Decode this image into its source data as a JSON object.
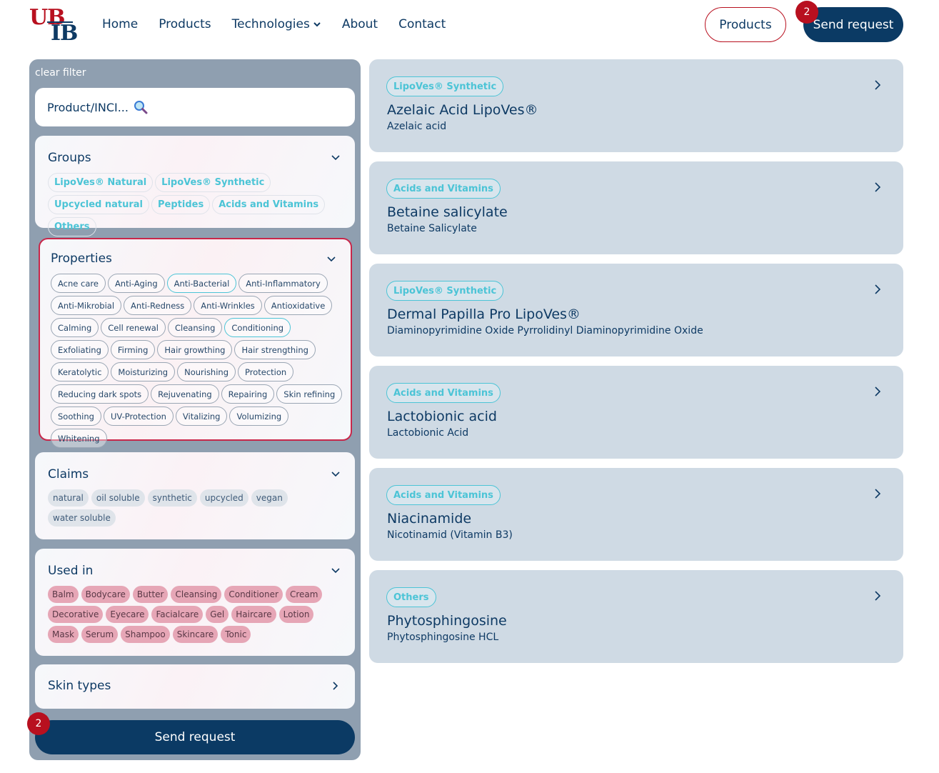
{
  "header": {
    "logo_top": "UB",
    "logo_bottom": "IB",
    "nav": [
      "Home",
      "Products",
      "Technologies",
      "About",
      "Contact"
    ],
    "products_button": "Products",
    "send_request_button": "Send request",
    "request_count": "2"
  },
  "sidebar": {
    "clear_filter": "clear filter",
    "search_placeholder": "Product/INCI...",
    "groups": {
      "title": "Groups",
      "items": [
        "LipoVes® Natural",
        "LipoVes® Synthetic",
        "Upcycled natural",
        "Peptides",
        "Acids and Vitamins",
        "Others"
      ]
    },
    "properties": {
      "title": "Properties",
      "items": [
        "Acne care",
        "Anti-Aging",
        "Anti-Bacterial",
        "Anti-Inflammatory",
        "Anti-Mikrobial",
        "Anti-Redness",
        "Anti-Wrinkles",
        "Antioxidative",
        "Calming",
        "Cell renewal",
        "Cleansing",
        "Conditioning",
        "Exfoliating",
        "Firming",
        "Hair growthing",
        "Hair strengthing",
        "Keratolytic",
        "Moisturizing",
        "Nourishing",
        "Protection",
        "Reducing dark spots",
        "Rejuvenating",
        "Repairing",
        "Skin refining",
        "Soothing",
        "UV-Protection",
        "Vitalizing",
        "Volumizing",
        "Whitening"
      ],
      "selected": [
        "Anti-Bacterial",
        "Conditioning"
      ]
    },
    "claims": {
      "title": "Claims",
      "items": [
        "natural",
        "oil soluble",
        "synthetic",
        "upcycled",
        "vegan",
        "water soluble"
      ]
    },
    "used_in": {
      "title": "Used in",
      "items": [
        "Balm",
        "Bodycare",
        "Butter",
        "Cleansing",
        "Conditioner",
        "Cream",
        "Decorative",
        "Eyecare",
        "Facialcare",
        "Gel",
        "Haircare",
        "Lotion",
        "Mask",
        "Serum",
        "Shampoo",
        "Skincare",
        "Tonic"
      ]
    },
    "skin_types": {
      "title": "Skin types"
    },
    "send_request": "Send request",
    "request_count": "2"
  },
  "products": [
    {
      "tag": "LipoVes® Synthetic",
      "name": "Azelaic Acid LipoVes®",
      "inci": "Azelaic acid"
    },
    {
      "tag": "Acids and Vitamins",
      "name": "Betaine salicylate",
      "inci": "Betaine Salicylate"
    },
    {
      "tag": "LipoVes® Synthetic",
      "name": "Dermal Papilla Pro LipoVes®",
      "inci": "Diaminopyrimidine Oxide Pyrrolidinyl Diaminopyrimidine Oxide"
    },
    {
      "tag": "Acids and Vitamins",
      "name": "Lactobionic acid",
      "inci": "Lactobionic Acid"
    },
    {
      "tag": "Acids and Vitamins",
      "name": "Niacinamide",
      "inci": "Nicotinamid (Vitamin B3)"
    },
    {
      "tag": "Others",
      "name": "Phytosphingosine",
      "inci": "Phytosphingosine HCL"
    }
  ],
  "colors": {
    "navy": "#0b3a64",
    "brand_red": "#b8101f",
    "accent_cyan": "#4cc4d6",
    "sidebar_bg": "#8f9fb0",
    "card_bg": "#cfdae4",
    "used_in_chip": "#e6a6b6"
  }
}
